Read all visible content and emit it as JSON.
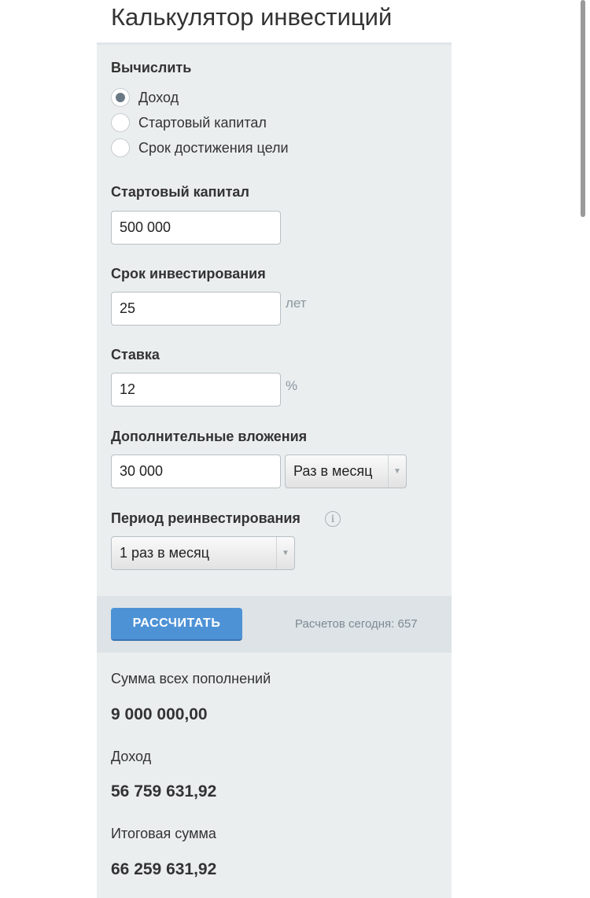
{
  "page": {
    "title": "Калькулятор инвестиций"
  },
  "calculate": {
    "label": "Вычислить",
    "options": [
      {
        "label": "Доход",
        "selected": true
      },
      {
        "label": "Стартовый капитал",
        "selected": false
      },
      {
        "label": "Срок достижения цели",
        "selected": false
      }
    ]
  },
  "start_capital": {
    "label": "Стартовый капитал",
    "value": "500 000"
  },
  "term": {
    "label": "Срок инвестирования",
    "value": "25",
    "unit": "лет"
  },
  "rate": {
    "label": "Ставка",
    "value": "12",
    "unit": "%"
  },
  "additional": {
    "label": "Дополнительные вложения",
    "value": "30 000",
    "frequency": "Раз в месяц"
  },
  "reinvest": {
    "label": "Период реинвестирования",
    "info_icon": "i",
    "value": "1 раз в месяц"
  },
  "action": {
    "button_label": "РАССЧИТАТЬ",
    "count_text": "Расчетов сегодня: 657"
  },
  "results": {
    "deposits_label": "Сумма всех пополнений",
    "deposits_value": "9 000 000,00",
    "income_label": "Доход",
    "income_value": "56 759 631,92",
    "total_label": "Итоговая сумма",
    "total_value": "66 259 631,92"
  },
  "colors": {
    "accent": "#4e92d6",
    "panel": "#eaeeef",
    "action_bar": "#dde3e6"
  }
}
